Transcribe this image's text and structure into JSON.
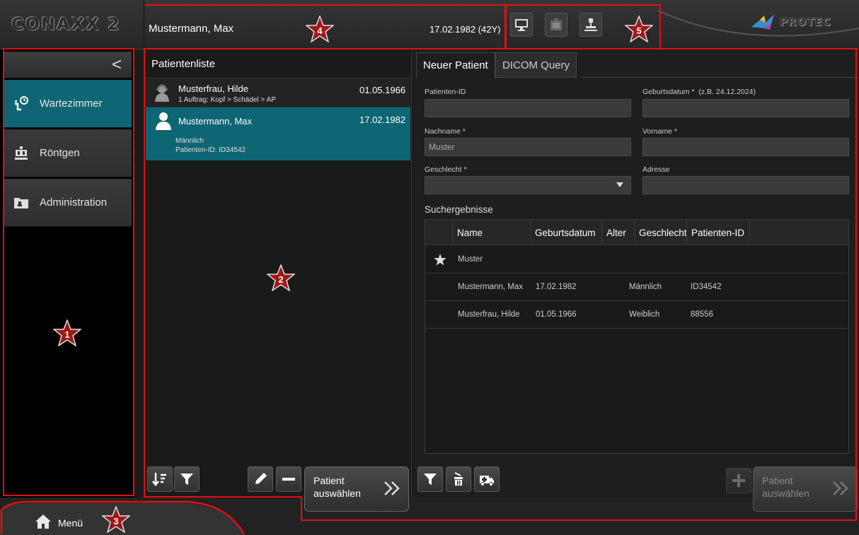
{
  "app": {
    "logo": "CONAXX 2",
    "brand": "PROTEC"
  },
  "header": {
    "patient_name": "Mustermann, Max",
    "patient_dob": "17.02.1982 (42Y)",
    "icons": [
      "monitor-icon",
      "cassette-icon",
      "xray-device-icon"
    ]
  },
  "sidebar": {
    "collapse_glyph": "<",
    "items": [
      {
        "label": "Wartezimmer",
        "icon": "waiting-room-icon",
        "active": true
      },
      {
        "label": "Röntgen",
        "icon": "xray-icon",
        "active": false
      },
      {
        "label": "Administration",
        "icon": "folder-icon",
        "active": false
      }
    ]
  },
  "patient_list": {
    "title": "Patientenliste",
    "patients": [
      {
        "name": "Musterfrau, Hilde",
        "date": "01.05.1966",
        "sub": "1 Auftrag: Kopf > Schädel > AP"
      },
      {
        "name": "Mustermann, Max",
        "date": "17.02.1982",
        "detail1": "Männlich",
        "detail2": "Patienten-ID: ID34542"
      }
    ],
    "select_button": "Patient auswählen"
  },
  "form": {
    "tabs": [
      "Neuer Patient",
      "DICOM Query"
    ],
    "patient_id_label": "Patienten-ID",
    "patient_id_value": "",
    "birthdate_label": "Geburtsdatum *",
    "birthdate_hint": "(z.B. 24.12.2024)",
    "lastname_label": "Nachname *",
    "lastname_value": "Muster",
    "firstname_label": "Vorname *",
    "gender_label": "Geschlecht *",
    "address_label": "Adresse"
  },
  "results": {
    "title": "Suchergebnisse",
    "columns": [
      "Name",
      "Geburtsdatum",
      "Alter",
      "Geschlecht",
      "Patienten-ID"
    ],
    "favorite_row": "Muster",
    "rows": [
      {
        "name": "Mustermann, Max",
        "dob": "17.02.1982",
        "age": "",
        "gender": "Männlich",
        "id": "ID34542"
      },
      {
        "name": "Musterfrau, Hilde",
        "dob": "01.05.1966",
        "age": "",
        "gender": "Weiblich",
        "id": "88556"
      }
    ],
    "select_button": "Patient auswählen"
  },
  "bottom": {
    "menu_label": "Menü"
  },
  "annotations": [
    "1",
    "2",
    "3",
    "4",
    "5"
  ],
  "colors": {
    "accent": "#0e6674",
    "annotation": "#e01010"
  }
}
